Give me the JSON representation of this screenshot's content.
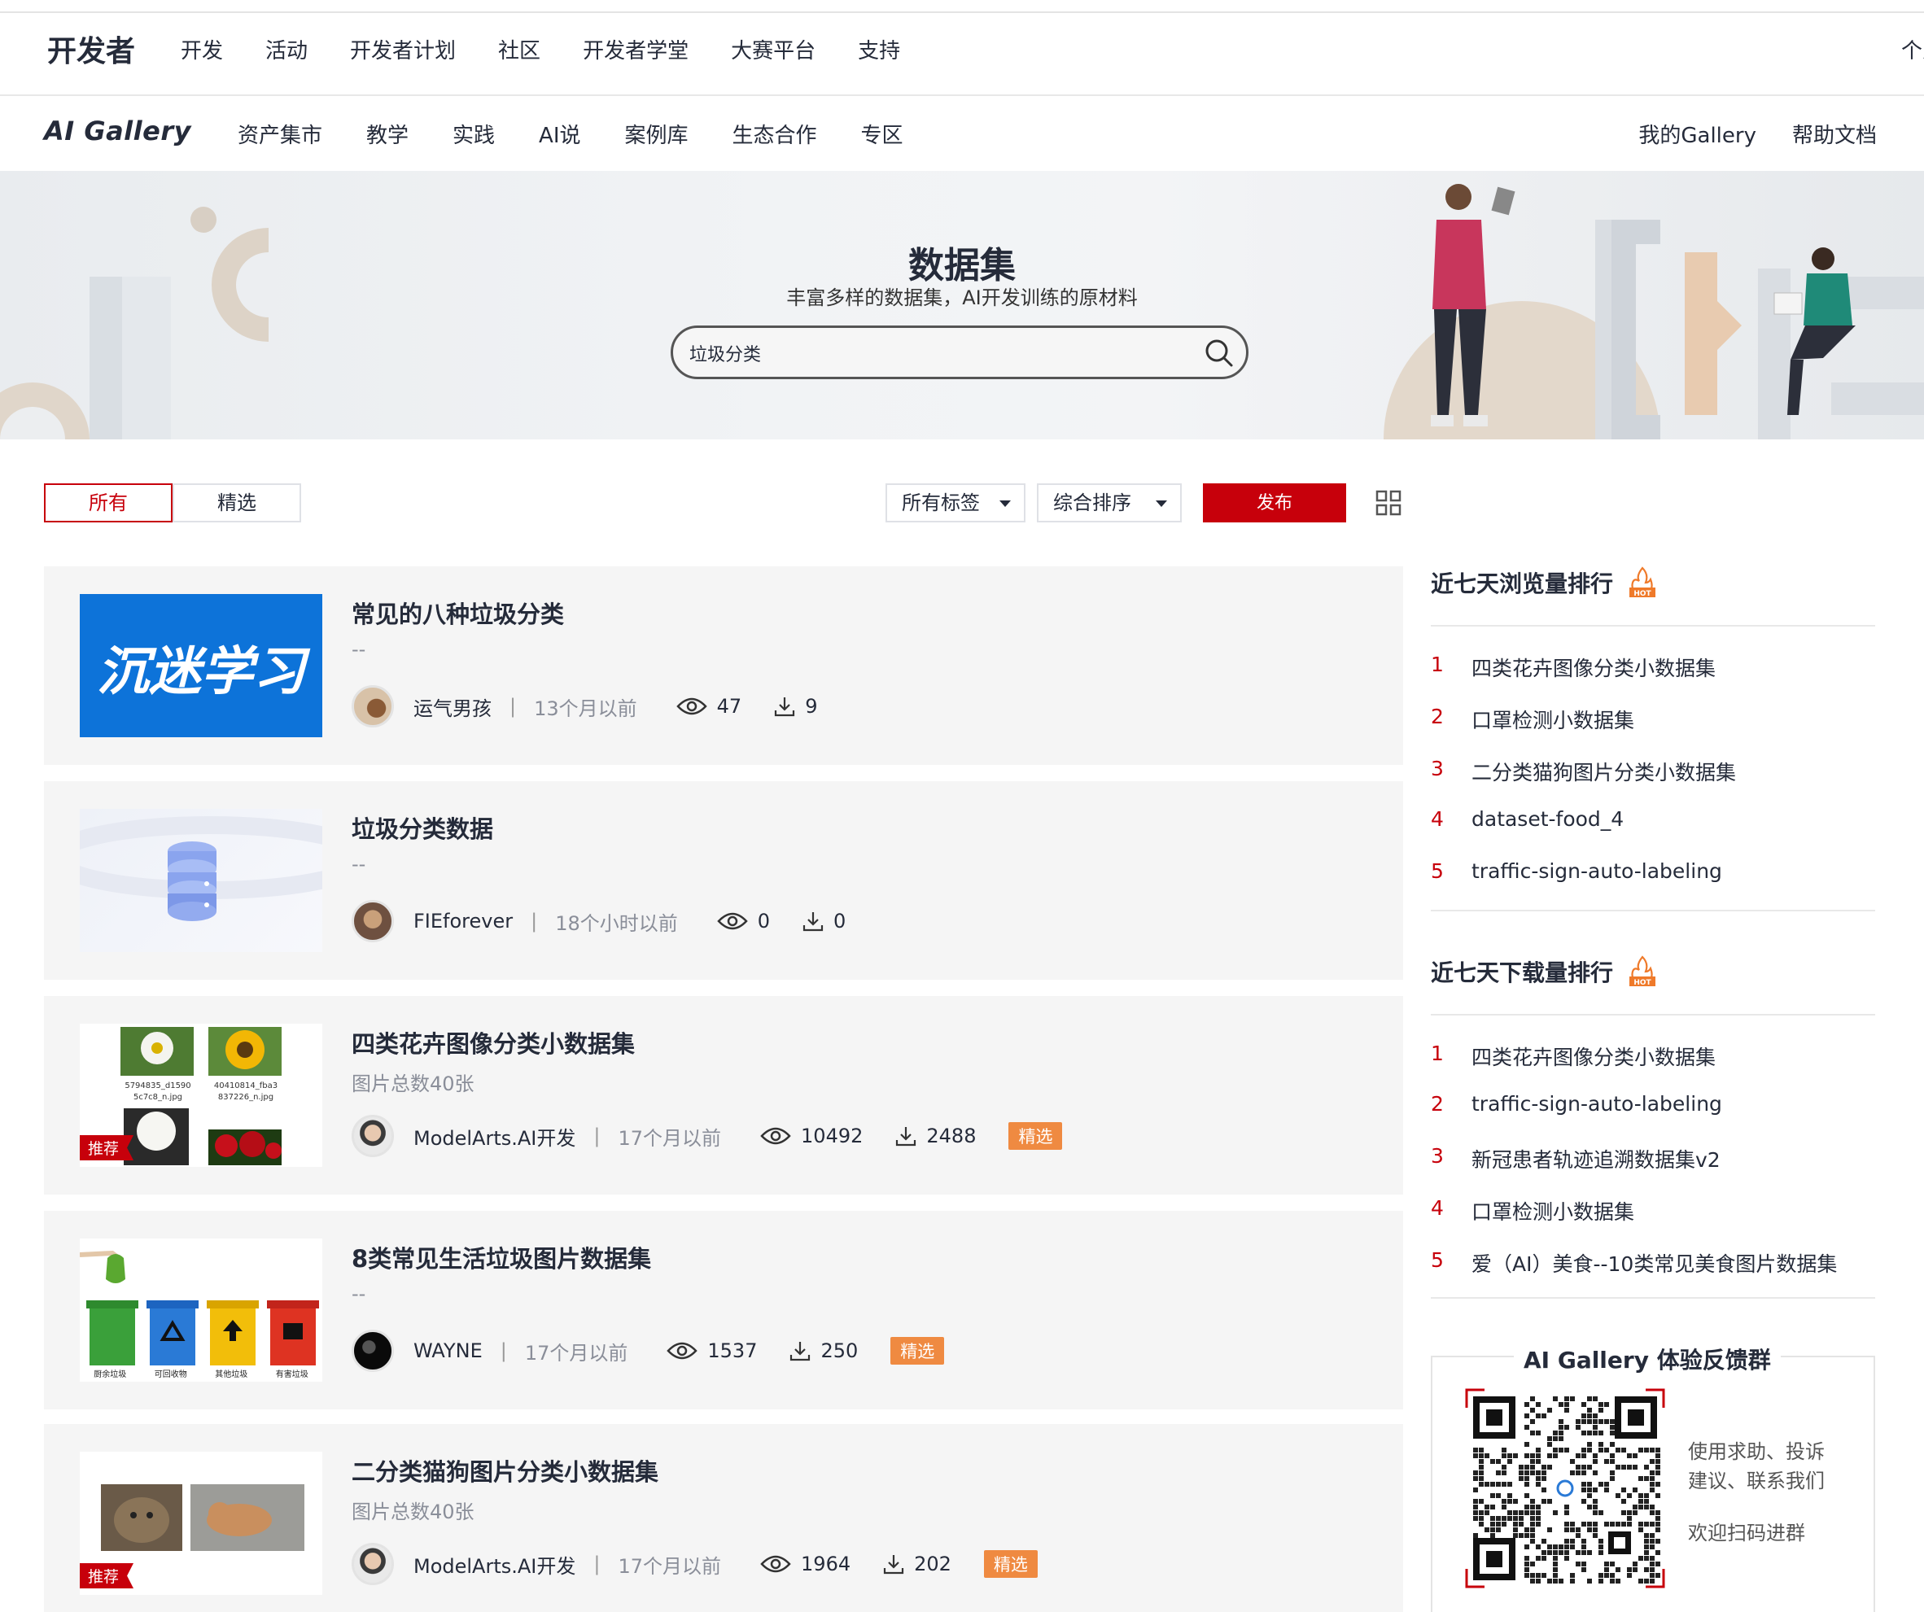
{
  "topnav": {
    "brand": "开发者",
    "items": [
      "开发",
      "活动",
      "开发者计划",
      "社区",
      "开发者学堂",
      "大赛平台",
      "支持"
    ],
    "edge_text": "个人"
  },
  "subnav": {
    "logo": "AI Gallery",
    "items": [
      "资产集市",
      "教学",
      "实践",
      "AI说",
      "案例库",
      "生态合作",
      "专区"
    ],
    "right": [
      "我的Gallery",
      "帮助文档"
    ]
  },
  "banner": {
    "title": "数据集",
    "subtitle": "丰富多样的数据集，AI开发训练的原材料",
    "search_value": "垃圾分类"
  },
  "filters": {
    "tabs": [
      "所有",
      "精选"
    ],
    "tag_select": "所有标签",
    "sort_select": "综合排序",
    "publish": "发布"
  },
  "cards": [
    {
      "title": "常见的八种垃圾分类",
      "desc": "--",
      "author": "运气男孩",
      "time": "13个月以前",
      "views": "47",
      "downloads": "9",
      "badge": "",
      "thumb_text": "沉迷学习"
    },
    {
      "title": "垃圾分类数据",
      "desc": "--",
      "author": "FIEforever",
      "time": "18个小时以前",
      "views": "0",
      "downloads": "0",
      "badge": ""
    },
    {
      "title": "四类花卉图像分类小数据集",
      "desc": "图片总数40张",
      "author": "ModelArts.AI开发",
      "time": "17个月以前",
      "views": "10492",
      "downloads": "2488",
      "badge": "精选",
      "rec": "推荐",
      "thumb_captions": [
        "5794835_d1590\n5c7c8_n.jpg",
        "40410814_fba3\n837226_n.jpg"
      ]
    },
    {
      "title": "8类常见生活垃圾图片数据集",
      "desc": "--",
      "author": "WAYNE",
      "time": "17个月以前",
      "views": "1537",
      "downloads": "250",
      "badge": "精选",
      "bin_labels": [
        "厨余垃圾",
        "可回收物",
        "其他垃圾",
        "有害垃圾"
      ]
    },
    {
      "title": "二分类猫狗图片分类小数据集",
      "desc": "图片总数40张",
      "author": "ModelArts.AI开发",
      "time": "17个月以前",
      "views": "1964",
      "downloads": "202",
      "badge": "精选",
      "rec": "推荐"
    }
  ],
  "sidebar": {
    "views_title": "近七天浏览量排行",
    "views_rank": [
      "四类花卉图像分类小数据集",
      "口罩检测小数据集",
      "二分类猫狗图片分类小数据集",
      "dataset-food_4",
      "traffic-sign-auto-labeling"
    ],
    "downloads_title": "近七天下载量排行",
    "downloads_rank": [
      "四类花卉图像分类小数据集",
      "traffic-sign-auto-labeling",
      "新冠患者轨迹追溯数据集v2",
      "口罩检测小数据集",
      "爱（AI）美食--10类常见美食图片数据集"
    ],
    "hot_label": "HOT",
    "qr_title": "AI Gallery 体验反馈群",
    "qr_text1": "使用求助、投诉",
    "qr_text2": "建议、联系我们",
    "qr_text3": "欢迎扫码进群"
  },
  "colors": {
    "accent": "#c7000b",
    "badge": "#ef8a41",
    "card_bg": "#f5f5f5"
  }
}
